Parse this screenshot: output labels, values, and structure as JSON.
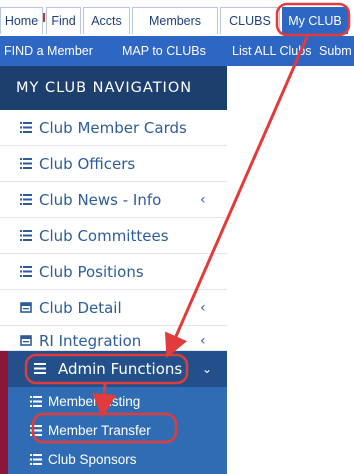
{
  "top_tabs": [
    {
      "label": "Home",
      "active": false
    },
    {
      "label": "Find",
      "active": false
    },
    {
      "label": "Accts",
      "active": false
    },
    {
      "label": "Members",
      "active": false
    },
    {
      "label": "CLUBS",
      "active": false
    },
    {
      "label": "My CLUB",
      "active": true
    }
  ],
  "sub_nav": [
    {
      "label": "FIND a Member"
    },
    {
      "label": "MAP to CLUBs"
    },
    {
      "label": "List ALL Clubs"
    },
    {
      "label": "Subm"
    }
  ],
  "sidebar": {
    "header": "MY CLUB NAVIGATION",
    "items": [
      {
        "label": "Club Member Cards",
        "icon": "list-icon",
        "chevron": ""
      },
      {
        "label": "Club Officers",
        "icon": "list-icon",
        "chevron": ""
      },
      {
        "label": "Club News - Info",
        "icon": "list-icon",
        "chevron": "‹"
      },
      {
        "label": "Club Committees",
        "icon": "list-icon",
        "chevron": ""
      },
      {
        "label": "Club Positions",
        "icon": "list-icon",
        "chevron": ""
      },
      {
        "label": "Club Detail",
        "icon": "card-icon",
        "chevron": "‹"
      },
      {
        "label": "RI Integration",
        "icon": "card-icon",
        "chevron": "‹"
      }
    ],
    "admin": {
      "label": "Admin Functions",
      "icon": "list-icon",
      "chevron": "⌄",
      "sub_items": [
        {
          "label": "Member Listing",
          "icon": "list-icon"
        },
        {
          "label": "Member Transfer",
          "icon": "list-icon"
        },
        {
          "label": "Club Sponsors",
          "icon": "list-icon"
        }
      ]
    }
  },
  "colors": {
    "tab_active": "#2e66c3",
    "subnav_bg": "#2e66c3",
    "sidebar_header_bg": "#1c3f6e",
    "sidebar_bg": "#2f6cb3",
    "admin_bg": "#23508a",
    "admin_accent": "#8b1538",
    "nav_text": "#2c5d9a",
    "annotation_red": "#e23b3b"
  }
}
